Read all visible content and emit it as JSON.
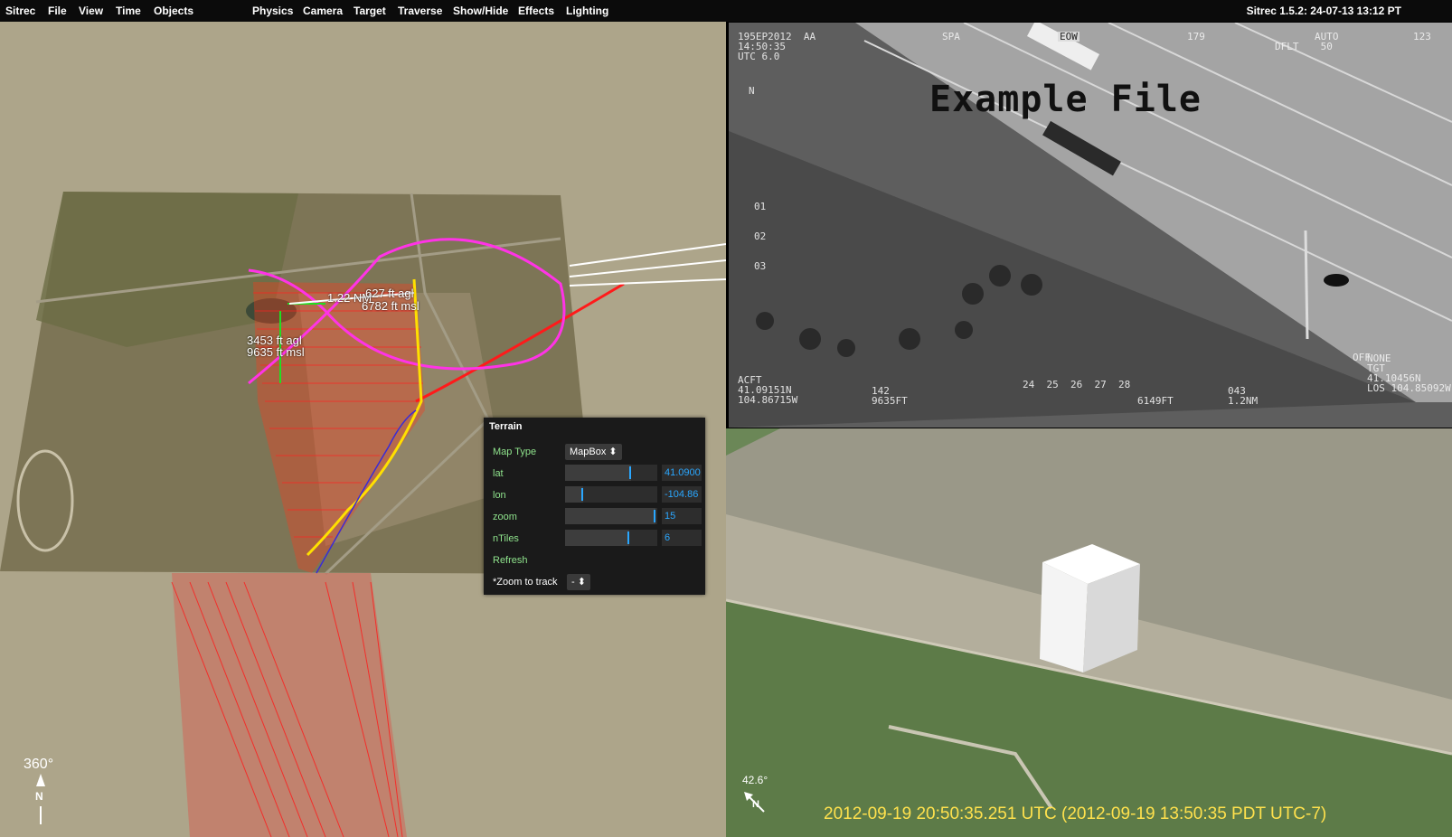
{
  "menu": {
    "app": "Sitrec",
    "items": [
      "File",
      "View",
      "Time",
      "Objects",
      "Physics",
      "Camera",
      "Target",
      "Traverse",
      "Show/Hide",
      "Effects",
      "Lighting"
    ],
    "version": "Sitrec 1.5.2: 24-07-13 13:12 PT"
  },
  "left_view": {
    "labels": {
      "range": "1.22 NM",
      "target_agl": "627 ft agl",
      "target_msl": "6782 ft msl",
      "camera_agl": "3453 ft agl",
      "camera_msl": "9635 ft msl"
    },
    "heading": "360°",
    "north": "N"
  },
  "terrain": {
    "title": "Terrain",
    "map_type_label": "Map Type",
    "map_type_value": "MapBox",
    "lat_label": "lat",
    "lat_value": "41.0900",
    "lat_level": 0.72,
    "lon_label": "lon",
    "lon_value": "-104.86",
    "lon_level": 0.2,
    "zoom_label": "zoom",
    "zoom_value": "15",
    "zoom_level": 0.98,
    "ntiles_label": "nTiles",
    "ntiles_value": "6",
    "ntiles_level": 0.7,
    "refresh_label": "Refresh",
    "zoom_track_label": "*Zoom to track",
    "zoom_track_value": "-"
  },
  "video": {
    "overlay_title": "Example File",
    "osd_top_left": "195EP2012  AA\n14:50:35\nUTC 6.0",
    "osd_spa": "SPA",
    "osd_eow": "EOW",
    "osd_179": "179",
    "osd_auto": "AUTO\n 50",
    "osd_dflt": "DFLT",
    "osd_123": "123",
    "osd_north": "N",
    "osd_ticks": [
      "01",
      "02",
      "03"
    ],
    "osd_scale": "24  25  26  27  28",
    "osd_acft": "ACFT\n41.09151N\n104.86715W",
    "osd_142": "142\n9635FT",
    "osd_6149": "6149FT",
    "osd_043": "043\n1.2NM",
    "osd_off": "OFF",
    "osd_right": "NONE\nTGT\n41.10456N\nLOS 104.85092W"
  },
  "sat_view": {
    "heading": "42.6°",
    "north": "N",
    "timestamp": "2012-09-19 20:50:35.251 UTC  (2012-09-19 13:50:35 PDT UTC-7)"
  },
  "colors": {
    "menubar": "#0b0b0b",
    "background": "#ada58a",
    "panel": "#1a1a1a",
    "label_green": "#8fe38c",
    "value_blue": "#2aa7ff",
    "timestamp_yellow": "#ffe14d",
    "frustum_red": "#ff1a1a",
    "track_magenta": "#ff33e6"
  }
}
